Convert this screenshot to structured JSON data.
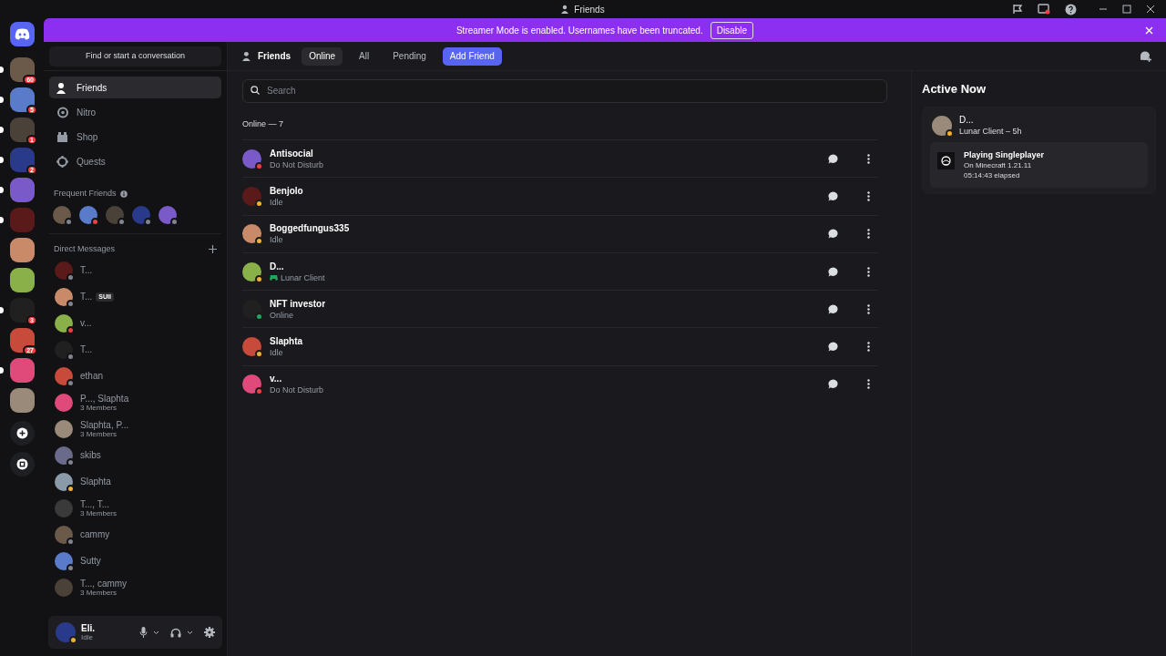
{
  "window": {
    "title": "Friends"
  },
  "banner": {
    "text": "Streamer Mode is enabled. Usernames have been truncated.",
    "button": "Disable"
  },
  "servers": [
    {
      "badge": "60",
      "unread": true
    },
    {
      "badge": "5",
      "unread": true
    },
    {
      "badge": "1",
      "unread": true
    },
    {
      "badge": "2",
      "unread": true
    },
    {
      "unread": true
    },
    {
      "unread": true
    },
    {
      "unread": false
    },
    {
      "unread": false
    },
    {
      "badge": "3",
      "unread": true
    },
    {
      "badge": "27",
      "unread": false
    },
    {
      "unread": true
    },
    {
      "unread": false
    }
  ],
  "sidebar": {
    "search": "Find or start a conversation",
    "nav": [
      {
        "label": "Friends",
        "selected": true
      },
      {
        "label": "Nitro",
        "selected": false
      },
      {
        "label": "Shop",
        "selected": false
      },
      {
        "label": "Quests",
        "selected": false
      }
    ],
    "frequent_title": "Frequent Friends",
    "frequent": [
      {
        "color": "#80848e"
      },
      {
        "color": "#f23f43"
      },
      {
        "color": "#80848e"
      },
      {
        "color": "#80848e"
      },
      {
        "color": "#80848e"
      }
    ],
    "dm_title": "Direct Messages",
    "dms": [
      {
        "name": "T...",
        "color": "#80848e"
      },
      {
        "name": "T...",
        "tag": "SUII",
        "color": "#80848e"
      },
      {
        "name": "v...",
        "color": "#f23f43"
      },
      {
        "name": "T...",
        "color": "#80848e"
      },
      {
        "name": "ethan",
        "color": "#80848e"
      },
      {
        "name": "P..., Slaphta",
        "members": "3 Members"
      },
      {
        "name": "Slaphta, P...",
        "members": "3 Members"
      },
      {
        "name": "skibs",
        "color": "#80848e"
      },
      {
        "name": "Slaphta",
        "color": "#f0b232"
      },
      {
        "name": "T..., T...",
        "members": "3 Members"
      },
      {
        "name": "cammy",
        "color": "#80848e"
      },
      {
        "name": "Sutty",
        "color": "#80848e"
      },
      {
        "name": "T..., cammy",
        "members": "3 Members"
      }
    ]
  },
  "user": {
    "name": "Eli.",
    "status_text": "Idle",
    "color": "#f0b232"
  },
  "topbar": {
    "title": "Friends",
    "tabs": [
      {
        "label": "Online",
        "selected": true
      },
      {
        "label": "All",
        "selected": false
      },
      {
        "label": "Pending",
        "selected": false
      }
    ],
    "add_friend": "Add Friend"
  },
  "search": {
    "placeholder": "Search"
  },
  "list_header": "Online — 7",
  "friends": [
    {
      "name": "Antisocial",
      "activity": "Do Not Disturb",
      "color": "#f23f43",
      "game": false
    },
    {
      "name": "Benjolo",
      "activity": "Idle",
      "color": "#f0b232",
      "game": false
    },
    {
      "name": "Boggedfungus335",
      "activity": "Idle",
      "color": "#f0b232",
      "game": false
    },
    {
      "name": "D...",
      "activity": "Lunar Client",
      "color": "#f0b232",
      "game": true
    },
    {
      "name": "NFT investor",
      "activity": "Online",
      "color": "#23a55a",
      "game": false
    },
    {
      "name": "Slaphta",
      "activity": "Idle",
      "color": "#f0b232",
      "game": false
    },
    {
      "name": "v...",
      "activity": "Do Not Disturb",
      "color": "#f23f43",
      "game": false
    }
  ],
  "active_now": {
    "title": "Active Now",
    "name": "D...",
    "subtitle": "Lunar Client – 5h",
    "color": "#f0b232",
    "activity_title": "Playing Singleplayer",
    "activity_detail": "On Minecraft 1.21.11",
    "elapsed": "05:14:43 elapsed"
  }
}
